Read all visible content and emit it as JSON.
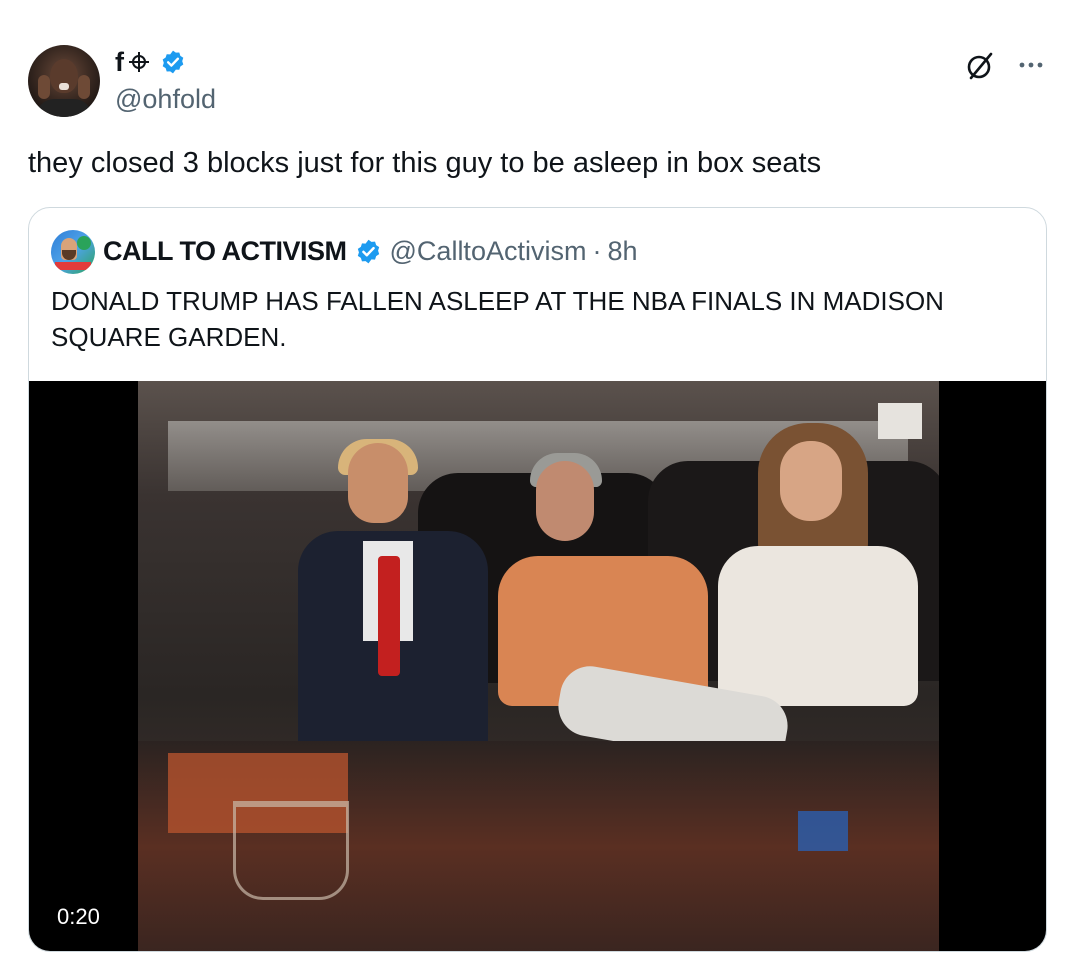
{
  "tweet": {
    "display_name": "f",
    "handle": "@ohfold",
    "text": "they closed 3 blocks just for this guy to be asleep in box seats"
  },
  "quote": {
    "display_name": "CALL TO ACTIVISM",
    "handle": "@CalltoActivism",
    "separator": "·",
    "time": "8h",
    "text": "DONALD TRUMP HAS FALLEN ASLEEP AT THE NBA FINALS IN MADISON SQUARE GARDEN.",
    "video_duration": "0:20"
  },
  "icons": {
    "verified": "verified-badge-icon",
    "grok": "grok-icon",
    "more": "more-options-icon",
    "crosshair": "crosshair-icon"
  },
  "colors": {
    "verified_blue": "#1d9bf0",
    "text_primary": "#0f1419",
    "text_secondary": "#536471",
    "border": "#cfd9de"
  }
}
